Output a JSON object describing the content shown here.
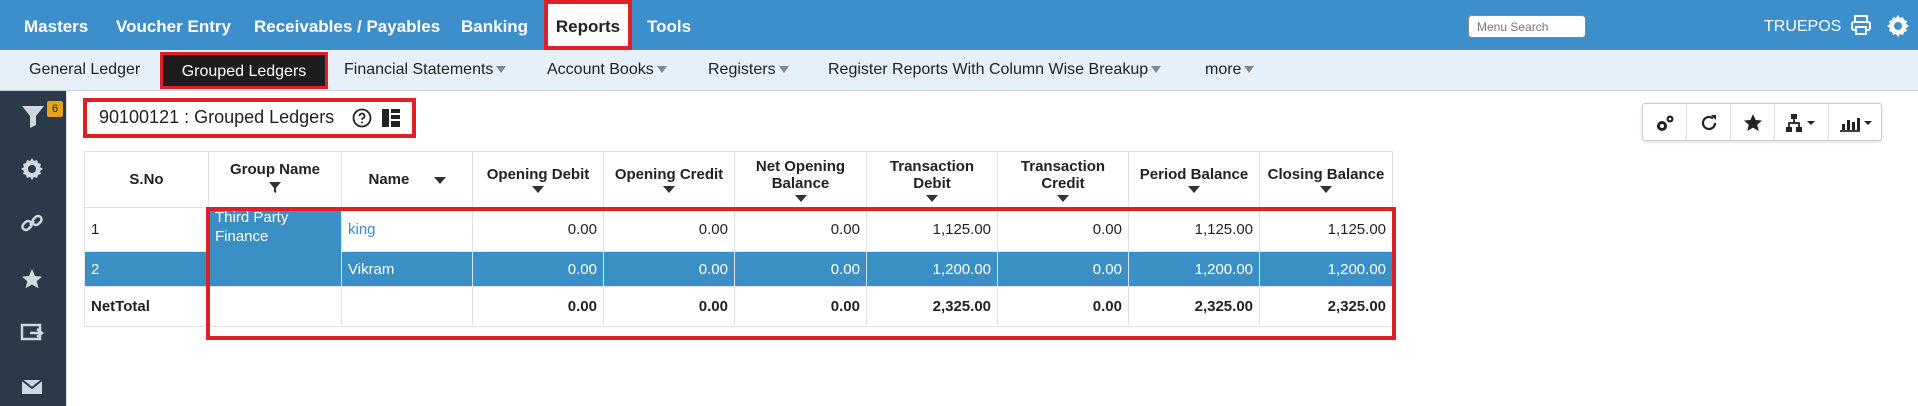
{
  "topnav": {
    "items": [
      "Masters",
      "Voucher Entry",
      "Receivables / Payables",
      "Banking",
      "Reports",
      "Tools"
    ],
    "search_placeholder": "Menu Search",
    "brand": "TRUEPOS"
  },
  "subnav": {
    "items": [
      "General Ledger",
      "Grouped Ledgers",
      "Financial Statements",
      "Account Books",
      "Registers",
      "Register Reports With Column Wise Breakup",
      "more"
    ]
  },
  "sidebar": {
    "filter_badge": "6"
  },
  "page": {
    "title": "90100121 : Grouped Ledgers"
  },
  "table": {
    "headers": {
      "sno": "S.No",
      "group_name": "Group Name",
      "name": "Name",
      "opening_debit": "Opening Debit",
      "opening_credit": "Opening Credit",
      "net_opening_balance": "Net Opening Balance",
      "transaction_debit": "Transaction Debit",
      "transaction_credit": "Transaction Credit",
      "period_balance": "Period Balance",
      "closing_balance": "Closing Balance"
    },
    "group": "Third Party Finance",
    "rows": [
      {
        "sno": "1",
        "name": "king",
        "opening_debit": "0.00",
        "opening_credit": "0.00",
        "net_opening_balance": "0.00",
        "transaction_debit": "1,125.00",
        "transaction_credit": "0.00",
        "period_balance": "1,125.00",
        "closing_balance": "1,125.00"
      },
      {
        "sno": "2",
        "name": "Vikram",
        "opening_debit": "0.00",
        "opening_credit": "0.00",
        "net_opening_balance": "0.00",
        "transaction_debit": "1,200.00",
        "transaction_credit": "0.00",
        "period_balance": "1,200.00",
        "closing_balance": "1,200.00"
      }
    ],
    "total": {
      "label": "NetTotal",
      "opening_debit": "0.00",
      "opening_credit": "0.00",
      "net_opening_balance": "0.00",
      "transaction_debit": "2,325.00",
      "transaction_credit": "0.00",
      "period_balance": "2,325.00",
      "closing_balance": "2,325.00"
    }
  },
  "icons": {
    "sidebar": [
      "filter-icon",
      "gear-icon",
      "link-icon",
      "star-icon",
      "export-icon",
      "mail-icon"
    ],
    "toolbar": [
      "settings-cogs-icon",
      "refresh-icon",
      "star-icon",
      "hierarchy-icon",
      "chart-icon"
    ]
  },
  "colors": {
    "header_blue": "#3d8fcb",
    "highlight": "#e01f26",
    "selected_row": "#3a8fc5",
    "sidebar": "#2b3a48"
  }
}
